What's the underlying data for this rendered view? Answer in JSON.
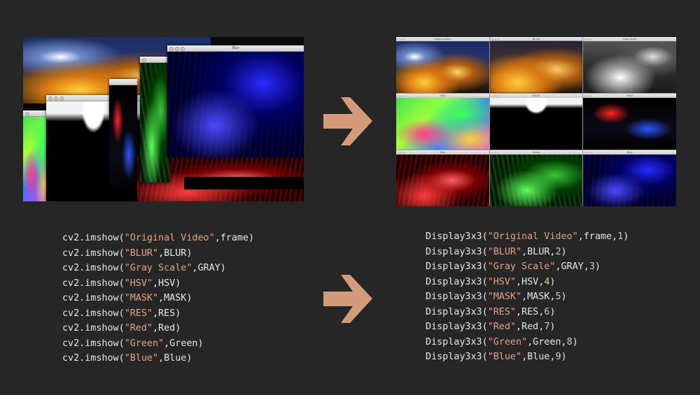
{
  "colors": {
    "background": "#262626",
    "arrow": "#d49b7a",
    "string": "#e6a37f",
    "number": "#b4e0a0",
    "code_text": "#e8e8e8"
  },
  "left_windows": [
    {
      "id": "orig",
      "title": "",
      "style": "city-orig"
    },
    {
      "id": "hsv",
      "title": "",
      "style": "city-hsv"
    },
    {
      "id": "mask",
      "title": "",
      "style": "city-mask"
    },
    {
      "id": "res",
      "title": "",
      "style": "city-res"
    },
    {
      "id": "red",
      "title": "",
      "style": "city-red"
    },
    {
      "id": "green",
      "title": "",
      "style": "city-green"
    },
    {
      "id": "blue",
      "title": "Blue",
      "style": "city-blue"
    }
  ],
  "grid_windows": [
    {
      "title": "Original Video",
      "style": "city-orig"
    },
    {
      "title": "BLUR",
      "style": "city-blur"
    },
    {
      "title": "Gray Scale",
      "style": "city-gray"
    },
    {
      "title": "HSV",
      "style": "city-hsv"
    },
    {
      "title": "MASK",
      "style": "city-mask"
    },
    {
      "title": "RES",
      "style": "city-res"
    },
    {
      "title": "Red",
      "style": "city-red"
    },
    {
      "title": "Green",
      "style": "city-green"
    },
    {
      "title": "Blue",
      "style": "city-blue"
    }
  ],
  "arrows": [
    "right-arrow-icon",
    "right-arrow-icon"
  ],
  "left_code": [
    {
      "fn": "cv2.imshow(",
      "label": "\"Original Video\"",
      "rest": ",frame)"
    },
    {
      "fn": "cv2.imshow(",
      "label": "\"BLUR\"",
      "rest": ",BLUR)"
    },
    {
      "fn": "cv2.imshow(",
      "label": "\"Gray Scale\"",
      "rest": ",GRAY)"
    },
    {
      "fn": "cv2.imshow(",
      "label": "\"HSV\"",
      "rest": ",HSV)"
    },
    {
      "fn": "cv2.imshow(",
      "label": "\"MASK\"",
      "rest": ",MASK)"
    },
    {
      "fn": "cv2.imshow(",
      "label": "\"RES\"",
      "rest": ",RES)"
    },
    {
      "fn": "cv2.imshow(",
      "label": "\"Red\"",
      "rest": ",Red)"
    },
    {
      "fn": "cv2.imshow(",
      "label": "\"Green\"",
      "rest": ",Green)"
    },
    {
      "fn": "cv2.imshow(",
      "label": "\"Blue\"",
      "rest": ",Blue)"
    }
  ],
  "right_code": [
    {
      "fn": "Display3x3(",
      "label": "\"Original Video\"",
      "var": ",frame,",
      "num": "1",
      "end": ")"
    },
    {
      "fn": "Display3x3(",
      "label": "\"BLUR\"",
      "var": ",BLUR,",
      "num": "2",
      "end": ")"
    },
    {
      "fn": "Display3x3(",
      "label": "\"Gray Scale\"",
      "var": ",GRAY,",
      "num": "3",
      "end": ")"
    },
    {
      "fn": "Display3x3(",
      "label": "\"HSV\"",
      "var": ",HSV,",
      "num": "4",
      "end": ")"
    },
    {
      "fn": "Display3x3(",
      "label": "\"MASK\"",
      "var": ",MASK,",
      "num": "5",
      "end": ")"
    },
    {
      "fn": "Display3x3(",
      "label": "\"RES\"",
      "var": ",RES,",
      "num": "6",
      "end": ")"
    },
    {
      "fn": "Display3x3(",
      "label": "\"Red\"",
      "var": ",Red,",
      "num": "7",
      "end": ")"
    },
    {
      "fn": "Display3x3(",
      "label": "\"Green\"",
      "var": ",Green,",
      "num": "8",
      "end": ")"
    },
    {
      "fn": "Display3x3(",
      "label": "\"Blue\"",
      "var": ",Blue,",
      "num": "9",
      "end": ")"
    }
  ]
}
